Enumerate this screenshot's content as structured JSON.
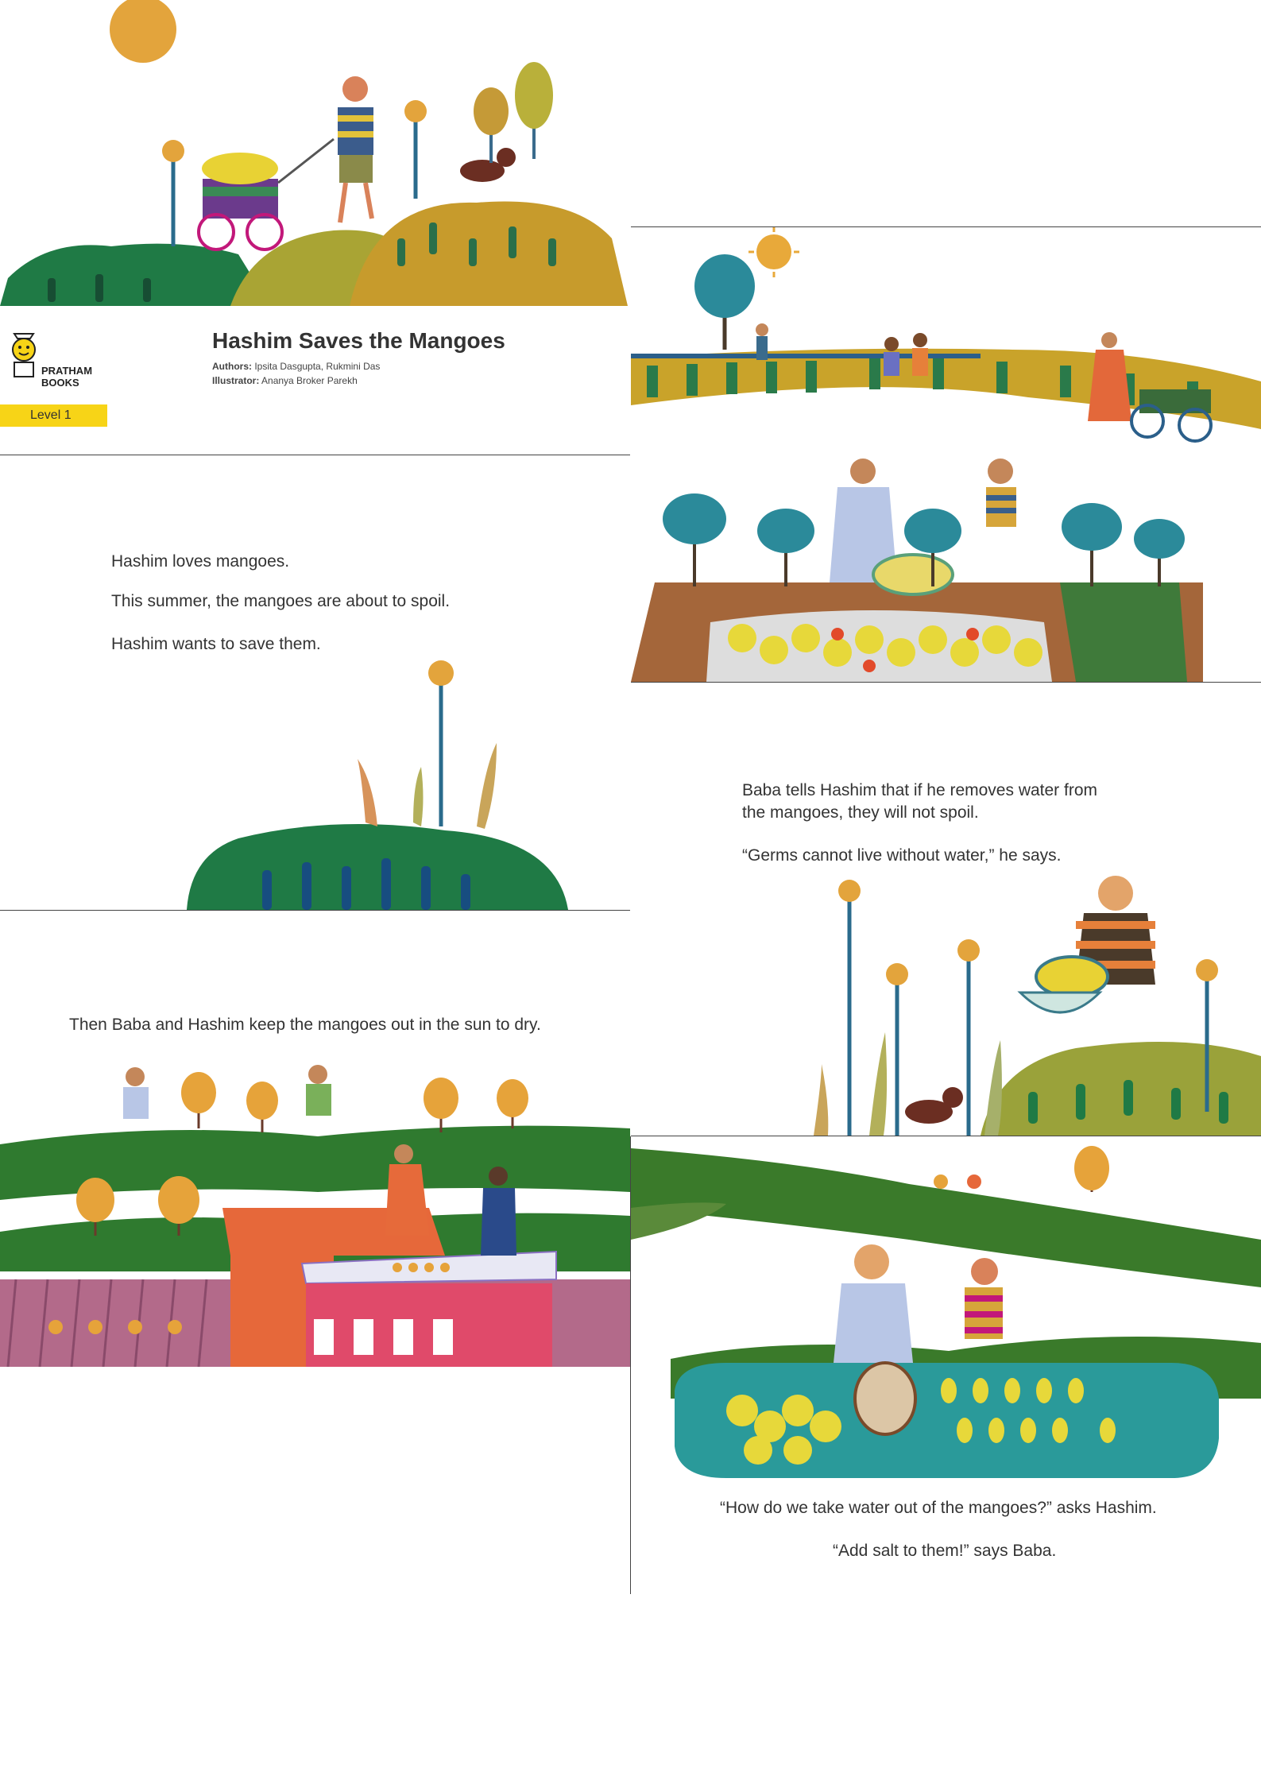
{
  "cover": {
    "title": "Hashim Saves the Mangoes",
    "authors_label": "Authors:",
    "authors": "Ipsita Dasgupta, Rukmini Das",
    "illustrator_label": "Illustrator:",
    "illustrator": "Ananya Broker Parekh",
    "publisher_line1": "PRATHAM",
    "publisher_line2": "BOOKS",
    "level": "Level 1"
  },
  "page2": {
    "line1": "Hashim loves mangoes.",
    "line2": "This summer, the mangoes are about to spoil.",
    "line3": "Hashim wants to save them."
  },
  "page3": {
    "line1": "Baba tells Hashim that if he removes water from",
    "line2": "the mangoes, they will not spoil.",
    "line3": "“Germs cannot live without water,” he says."
  },
  "page4": {
    "line1": "Then Baba and Hashim keep the mangoes out in the sun to dry."
  },
  "page5": {
    "line1": "“How do we take water out of the mangoes?” asks Hashim.",
    "line2": "“Add salt to them!” says Baba."
  },
  "colors": {
    "accent": "#f7d417",
    "grass_dark": "#1f7a45",
    "grass_mid": "#3d8f3a",
    "ochre": "#c9a32a",
    "sky_sun": "#e8a93a"
  }
}
